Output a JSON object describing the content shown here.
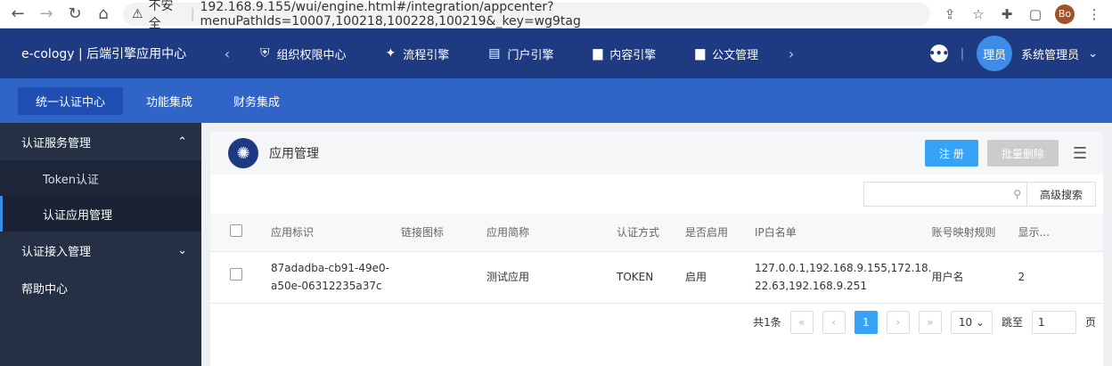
{
  "browser": {
    "insecure_label": "不安全",
    "url": "192.168.9.155/wui/engine.html#/integration/appcenter?menuPathIds=10007,100218,100228,100219&_key=wg9tag",
    "profile_initials": "Bo"
  },
  "topbar": {
    "brand": "e-cology | 后端引擎应用中心",
    "nav": [
      {
        "label": "组织权限中心",
        "icon": "shield-icon"
      },
      {
        "label": "流程引擎",
        "icon": "flow-icon"
      },
      {
        "label": "门户引擎",
        "icon": "portal-icon"
      },
      {
        "label": "内容引擎",
        "icon": "document-icon"
      },
      {
        "label": "公文管理",
        "icon": "document-icon"
      }
    ],
    "avatar_text": "理员",
    "username": "系统管理员"
  },
  "subbar": {
    "tabs": [
      "统一认证中心",
      "功能集成",
      "财务集成"
    ]
  },
  "sidebar": {
    "group1": "认证服务管理",
    "sub1": "Token认证",
    "sub2": "认证应用管理",
    "group2": "认证接入管理",
    "group3": "帮助中心"
  },
  "main": {
    "title": "应用管理",
    "register_label": "注 册",
    "batch_delete_label": "批量删除",
    "advanced_search_label": "高级搜索",
    "columns": [
      "应用标识",
      "链接图标",
      "应用简称",
      "认证方式",
      "是否启用",
      "IP白名单",
      "账号映射规则",
      "显示..."
    ],
    "rows": [
      {
        "app_id_line1": "87adadba-cb91-49e0-",
        "app_id_line2": "a50e-06312235a37c",
        "link_icon": "",
        "short_name": "测试应用",
        "auth_method": "TOKEN",
        "enabled": "启用",
        "ip_line1": "127.0.0.1,192.168.9.155,172.18.",
        "ip_line2": "22.63,192.168.9.251",
        "mapping_rule": "用户名",
        "display": "2"
      }
    ],
    "pager": {
      "total": "共1条",
      "current_page": "1",
      "page_size": "10",
      "jump_label": "跳至",
      "jump_value": "1",
      "page_suffix": "页"
    }
  },
  "colors": {
    "topbar": "#1e3a80",
    "subbar": "#3164c7",
    "sidebar": "#263045",
    "accent": "#36a3f7"
  }
}
